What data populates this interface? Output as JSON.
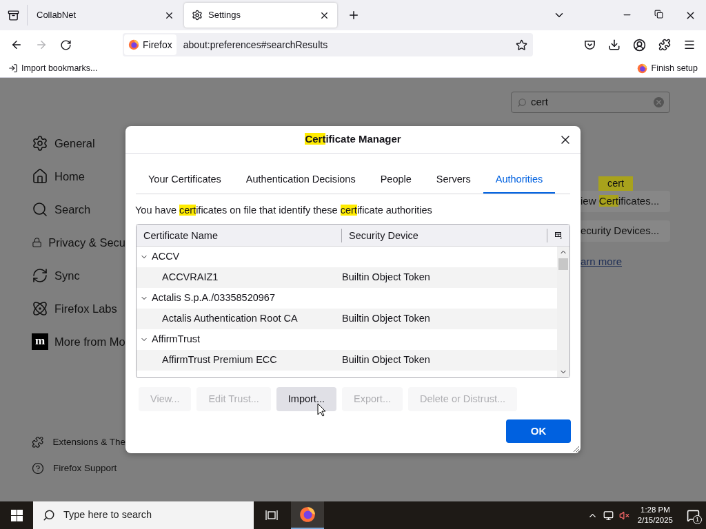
{
  "browser": {
    "tabs": [
      {
        "title": "CollabNet",
        "selected": false
      },
      {
        "title": "Settings",
        "selected": true
      }
    ],
    "nav": [
      {
        "kind": "back",
        "disabled": false
      },
      {
        "kind": "forward",
        "disabled": true
      },
      {
        "kind": "reload",
        "disabled": false
      }
    ],
    "identity": "Firefox",
    "url": "about:preferences#searchResults",
    "bookmarks": {
      "import": "Import bookmarks...",
      "finish": "Finish setup"
    }
  },
  "settings": {
    "search": {
      "value": "cert"
    },
    "sidebar": [
      {
        "label": "General"
      },
      {
        "label": "Home"
      },
      {
        "label": "Search"
      },
      {
        "label": "Privacy & Secu"
      },
      {
        "label": "Sync"
      },
      {
        "label": "Firefox Labs"
      },
      {
        "label": "More from Mo",
        "logo_text": "m"
      }
    ],
    "footer": [
      {
        "label": "Extensions & The"
      },
      {
        "label": "Firefox Support"
      }
    ],
    "results": {
      "tooltip": "cert",
      "buttons": [
        {
          "parts": [
            {
              "text": "iew ",
              "highlight": false
            },
            {
              "text": "Cert",
              "highlight": true
            },
            {
              "text": "ificates...",
              "highlight": false
            }
          ]
        },
        {
          "parts": [
            {
              "text": "ecurity Devices...",
              "highlight": false
            }
          ]
        }
      ],
      "link": "arn more"
    }
  },
  "dialog": {
    "title": [
      {
        "text": "Cert",
        "highlight": true
      },
      {
        "text": "ificate Manager",
        "highlight": false
      }
    ],
    "tabs": [
      {
        "label": "Your Certificates",
        "selected": false
      },
      {
        "label": "Authentication Decisions",
        "selected": false
      },
      {
        "label": "People",
        "selected": false
      },
      {
        "label": "Servers",
        "selected": false
      },
      {
        "label": "Authorities",
        "selected": true
      }
    ],
    "description": [
      {
        "text": "You have ",
        "highlight": false
      },
      {
        "text": "cert",
        "highlight": true
      },
      {
        "text": "ificates on file that identify these ",
        "highlight": false
      },
      {
        "text": "cert",
        "highlight": true
      },
      {
        "text": "ificate authorities",
        "highlight": false
      }
    ],
    "columns": [
      "Certificate Name",
      "Security Device"
    ],
    "tree": [
      {
        "name": "ACCV",
        "expanded": true,
        "children": [
          {
            "name": "ACCVRAIZ1",
            "device": "Builtin Object Token"
          }
        ]
      },
      {
        "name": "Actalis S.p.A./03358520967",
        "expanded": true,
        "children": [
          {
            "name": "Actalis Authentication Root CA",
            "device": "Builtin Object Token"
          }
        ]
      },
      {
        "name": "AffirmTrust",
        "expanded": true,
        "children": [
          {
            "name": "AffirmTrust Premium ECC",
            "device": "Builtin Object Token"
          }
        ]
      }
    ],
    "buttons": [
      {
        "label": "View...",
        "disabled": true,
        "hovered": false
      },
      {
        "label": "Edit Trust...",
        "disabled": true,
        "hovered": false
      },
      {
        "label": "Import...",
        "disabled": false,
        "hovered": true
      },
      {
        "label": "Export...",
        "disabled": true,
        "hovered": false
      },
      {
        "label": "Delete or Distrust...",
        "disabled": true,
        "hovered": false
      }
    ],
    "ok": "OK"
  },
  "taskbar": {
    "search_placeholder": "Type here to search",
    "apps": [
      {
        "kind": "task_view",
        "selected": false
      },
      {
        "kind": "firefox",
        "selected": true
      }
    ],
    "time": "1:28 PM",
    "date": "2/15/2025",
    "notifications": "1"
  }
}
